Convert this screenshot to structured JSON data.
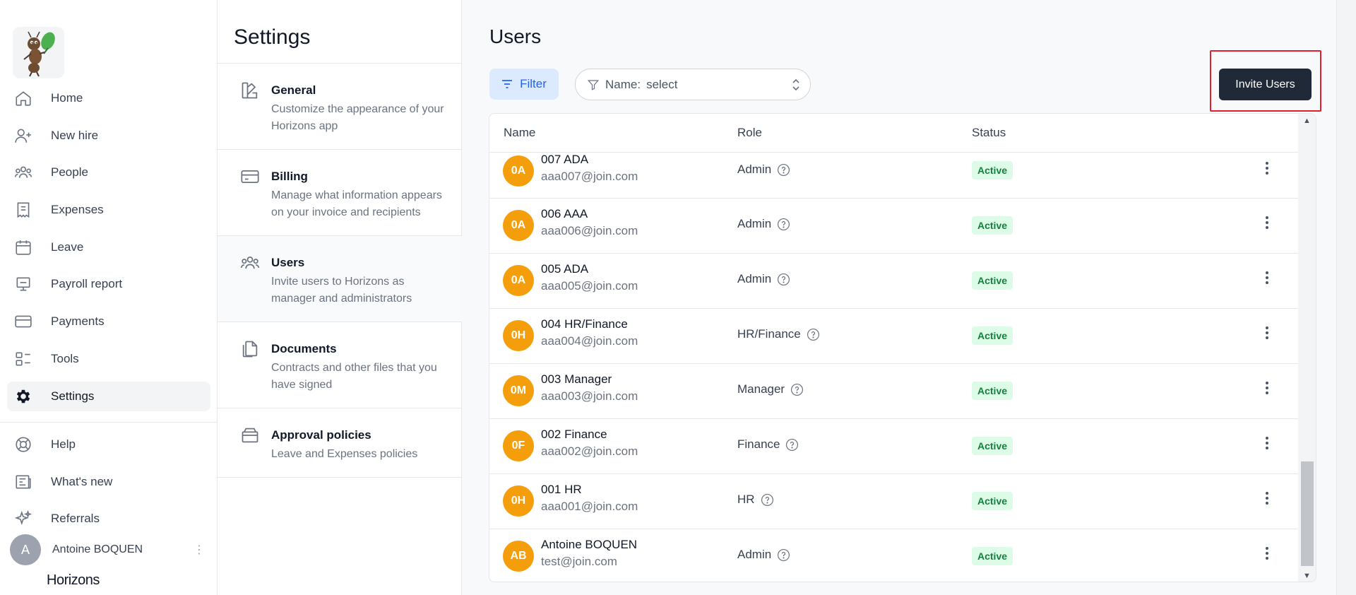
{
  "nav": {
    "items": [
      {
        "label": "Home",
        "icon": "home-icon"
      },
      {
        "label": "New hire",
        "icon": "user-plus-icon"
      },
      {
        "label": "People",
        "icon": "people-icon"
      },
      {
        "label": "Expenses",
        "icon": "receipt-icon"
      },
      {
        "label": "Leave",
        "icon": "calendar-icon"
      },
      {
        "label": "Payroll report",
        "icon": "payroll-icon"
      },
      {
        "label": "Payments",
        "icon": "card-icon"
      },
      {
        "label": "Tools",
        "icon": "tools-icon"
      },
      {
        "label": "Settings",
        "icon": "gear-icon",
        "active": true
      }
    ],
    "bottom_items": [
      {
        "label": "Help",
        "icon": "lifebuoy-icon"
      },
      {
        "label": "What's new",
        "icon": "newspaper-icon"
      },
      {
        "label": "Referrals",
        "icon": "sparkles-icon"
      }
    ],
    "user": {
      "initial": "A",
      "name": "Antoine BOQUEN",
      "more": "⋮"
    },
    "brand": "Horizons"
  },
  "settings": {
    "title": "Settings",
    "items": [
      {
        "title": "General",
        "description": "Customize the appearance of your Horizons app",
        "icon": "palette-icon"
      },
      {
        "title": "Billing",
        "description": "Manage what information appears on your invoice and recipients",
        "icon": "card-icon"
      },
      {
        "title": "Users",
        "description": "Invite users to Horizons as manager and administrators",
        "icon": "people-icon",
        "active": true
      },
      {
        "title": "Documents",
        "description": "Contracts and other files that you have signed",
        "icon": "documents-icon"
      },
      {
        "title": "Approval policies",
        "description": "Leave and Expenses policies",
        "icon": "archive-icon"
      }
    ]
  },
  "main": {
    "title": "Users",
    "filter_label": "Filter",
    "name_select": {
      "label": "Name:",
      "value": "select"
    },
    "invite_label": "Invite Users",
    "table": {
      "columns": [
        "Name",
        "Role",
        "Status"
      ],
      "rows": [
        {
          "initials": "0A",
          "name": "007 ADA",
          "email": "aaa007@join.com",
          "role": "Admin",
          "status": "Active"
        },
        {
          "initials": "0A",
          "name": "006 AAA",
          "email": "aaa006@join.com",
          "role": "Admin",
          "status": "Active"
        },
        {
          "initials": "0A",
          "name": "005 ADA",
          "email": "aaa005@join.com",
          "role": "Admin",
          "status": "Active"
        },
        {
          "initials": "0H",
          "name": "004 HR/Finance",
          "email": "aaa004@join.com",
          "role": "HR/Finance",
          "status": "Active"
        },
        {
          "initials": "0M",
          "name": "003 Manager",
          "email": "aaa003@join.com",
          "role": "Manager",
          "status": "Active"
        },
        {
          "initials": "0F",
          "name": "002 Finance",
          "email": "aaa002@join.com",
          "role": "Finance",
          "status": "Active"
        },
        {
          "initials": "0H",
          "name": "001 HR",
          "email": "aaa001@join.com",
          "role": "HR",
          "status": "Active"
        },
        {
          "initials": "AB",
          "name": "Antoine BOQUEN",
          "email": "test@join.com",
          "role": "Admin",
          "status": "Active"
        }
      ]
    }
  },
  "colors": {
    "accent": "#2563eb",
    "avatar": "#f59e0b",
    "active_badge_bg": "#dcfce7",
    "active_badge_text": "#15803d",
    "invite_button": "#1f2937",
    "highlight_border": "#e11d2e"
  }
}
